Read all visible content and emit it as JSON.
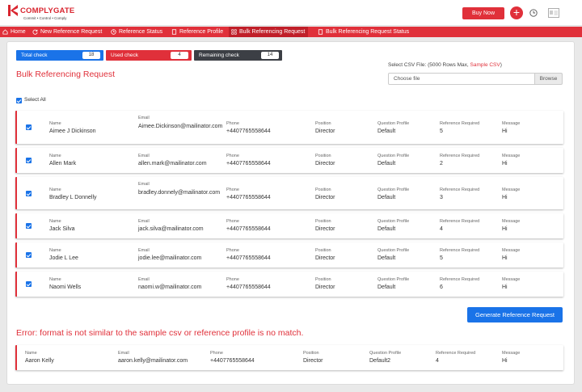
{
  "header": {
    "brand_name": "COMPLYGATE",
    "brand_tagline": "Commit • Control • Comply",
    "buy_now_label": "Buy Now",
    "add_icon": "plus-icon",
    "clock_icon": "clock-icon",
    "card_icon": "id-card-icon"
  },
  "nav": {
    "items": [
      {
        "label": "Home",
        "icon": "home-icon"
      },
      {
        "label": "New Reference Request",
        "icon": "refresh-icon"
      },
      {
        "label": "Reference Status",
        "icon": "clock-icon"
      },
      {
        "label": "Reference Profile",
        "icon": "document-icon"
      },
      {
        "label": "Bulk Referencing Request",
        "icon": "grid-icon",
        "active": true
      },
      {
        "label": "Bulk Referencing Request Status",
        "icon": "document-icon"
      }
    ]
  },
  "stats": {
    "total": {
      "label": "Total check",
      "value": "18"
    },
    "used": {
      "label": "Used check",
      "value": "4"
    },
    "remaining": {
      "label": "Remaining check",
      "value": "14"
    }
  },
  "page_title": "Bulk Referencing Request",
  "csv": {
    "label": "Select CSV File: (5000 Rows Max,",
    "sample_link": "Sample CSV",
    "label_suffix": ")",
    "file_placeholder": "Choose file",
    "browse_label": "Browse"
  },
  "select_all_label": "Select All",
  "columns": {
    "name": "Name",
    "email": "Email",
    "phone": "Phone",
    "position": "Position",
    "question_profile": "Question Profile",
    "reference_required": "Reference Required",
    "message": "Message"
  },
  "rows": [
    {
      "name": "Aimee J Dickinson",
      "email": "Aimee.Dickinson@mailinator.com",
      "phone": "+4407765558644",
      "position": "Director",
      "question_profile": "Default",
      "reference_required": "5",
      "message": "Hi",
      "checked": true
    },
    {
      "name": "Allen Mark",
      "email": "allen.mark@mailinator.com",
      "phone": "+4407765558644",
      "position": "Director",
      "question_profile": "Default",
      "reference_required": "2",
      "message": "Hi",
      "checked": true
    },
    {
      "name": "Bradley L Donnelly",
      "email": "bradley.donnely@mailinator.com",
      "phone": "+4407765558644",
      "position": "Director",
      "question_profile": "Default",
      "reference_required": "3",
      "message": "Hi",
      "checked": true
    },
    {
      "name": "Jack Silva",
      "email": "jack.silva@mailinator.com",
      "phone": "+4407765558644",
      "position": "Director",
      "question_profile": "Default",
      "reference_required": "4",
      "message": "Hi",
      "checked": true
    },
    {
      "name": "Jodie L Lee",
      "email": "jodie.lee@mailinator.com",
      "phone": "+4407765558644",
      "position": "Director",
      "question_profile": "Default",
      "reference_required": "5",
      "message": "Hi",
      "checked": true
    },
    {
      "name": "Naomi Wells",
      "email": "naomi.w@mailinator.com",
      "phone": "+4407765558644",
      "position": "Director",
      "question_profile": "Default",
      "reference_required": "6",
      "message": "Hi",
      "checked": true
    }
  ],
  "generate_button_label": "Generate Reference Request",
  "error_message": "Error: format is not similar to the sample csv or reference profile is no match.",
  "error_row": {
    "name": "Aaron Kelly",
    "email": "aaron.kelly@mailinator.com",
    "phone": "+4407765558644",
    "position": "Director",
    "question_profile": "Default2",
    "reference_required": "4",
    "message": "Hi"
  },
  "colors": {
    "brand_red": "#e0303a",
    "nav_active": "#c01f29",
    "accent_blue": "#1a73e8",
    "remaining_dark": "#3c3f45"
  }
}
